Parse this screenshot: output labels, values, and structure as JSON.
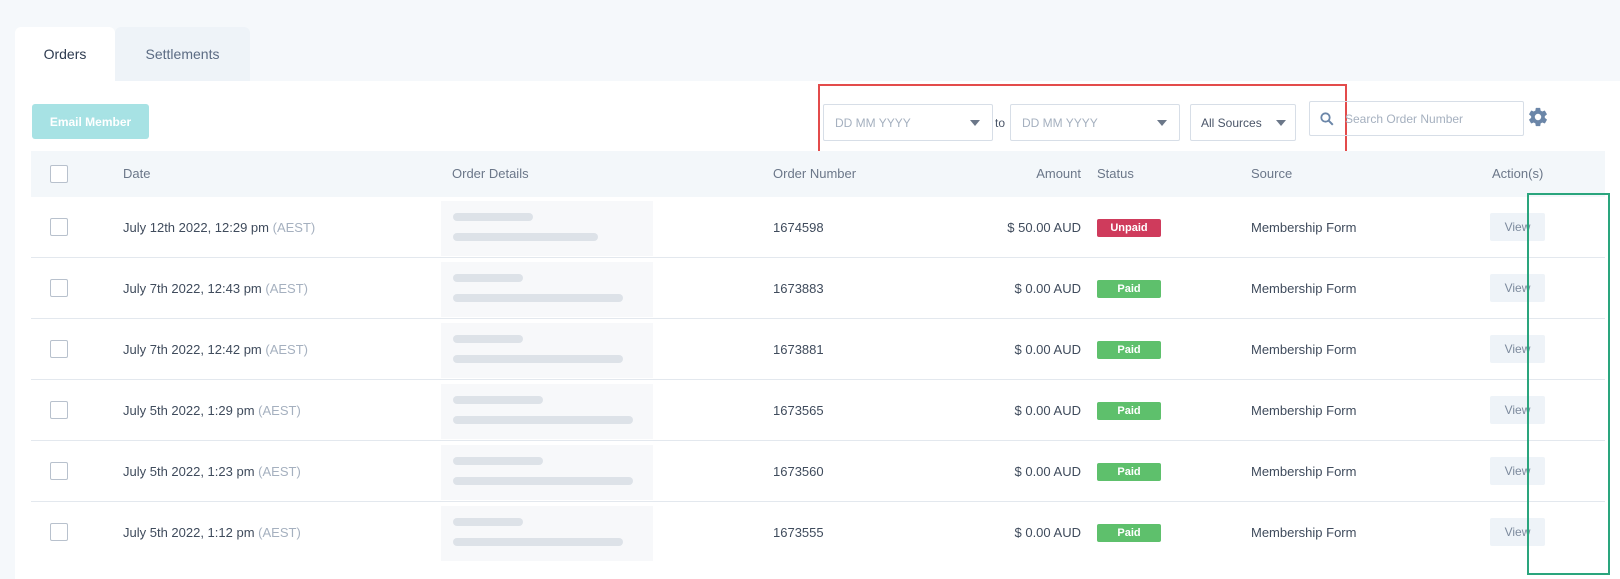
{
  "tabs": [
    {
      "label": "Orders",
      "active": true
    },
    {
      "label": "Settlements",
      "active": false
    }
  ],
  "toolbar": {
    "email_member": "Email Member",
    "date_from_placeholder": "DD MM YYYY",
    "to_label": "to",
    "date_to_placeholder": "DD MM YYYY",
    "source_select": "All Sources",
    "search_placeholder": "Search Order Number"
  },
  "table": {
    "headers": {
      "date": "Date",
      "order_details": "Order Details",
      "order_number": "Order Number",
      "amount": "Amount",
      "status": "Status",
      "source": "Source",
      "actions": "Action(s)"
    },
    "rows": [
      {
        "date": "July 12th 2022, 12:29 pm",
        "tz": "(AEST)",
        "order_number": "1674598",
        "amount": "$ 50.00 AUD",
        "status": "Unpaid",
        "status_color": "#cf3b5c",
        "source": "Membership Form",
        "action": "View"
      },
      {
        "date": "July 7th 2022, 12:43 pm",
        "tz": "(AEST)",
        "order_number": "1673883",
        "amount": "$ 0.00 AUD",
        "status": "Paid",
        "status_color": "#5ec06c",
        "source": "Membership Form",
        "action": "View"
      },
      {
        "date": "July 7th 2022, 12:42 pm",
        "tz": "(AEST)",
        "order_number": "1673881",
        "amount": "$ 0.00 AUD",
        "status": "Paid",
        "status_color": "#5ec06c",
        "source": "Membership Form",
        "action": "View"
      },
      {
        "date": "July 5th 2022, 1:29 pm",
        "tz": "(AEST)",
        "order_number": "1673565",
        "amount": "$ 0.00 AUD",
        "status": "Paid",
        "status_color": "#5ec06c",
        "source": "Membership Form",
        "action": "View"
      },
      {
        "date": "July 5th 2022, 1:23 pm",
        "tz": "(AEST)",
        "order_number": "1673560",
        "amount": "$ 0.00 AUD",
        "status": "Paid",
        "status_color": "#5ec06c",
        "source": "Membership Form",
        "action": "View"
      },
      {
        "date": "July 5th 2022, 1:12 pm",
        "tz": "(AEST)",
        "order_number": "1673555",
        "amount": "$ 0.00 AUD",
        "status": "Paid",
        "status_color": "#5ec06c",
        "source": "Membership Form",
        "action": "View"
      }
    ]
  }
}
